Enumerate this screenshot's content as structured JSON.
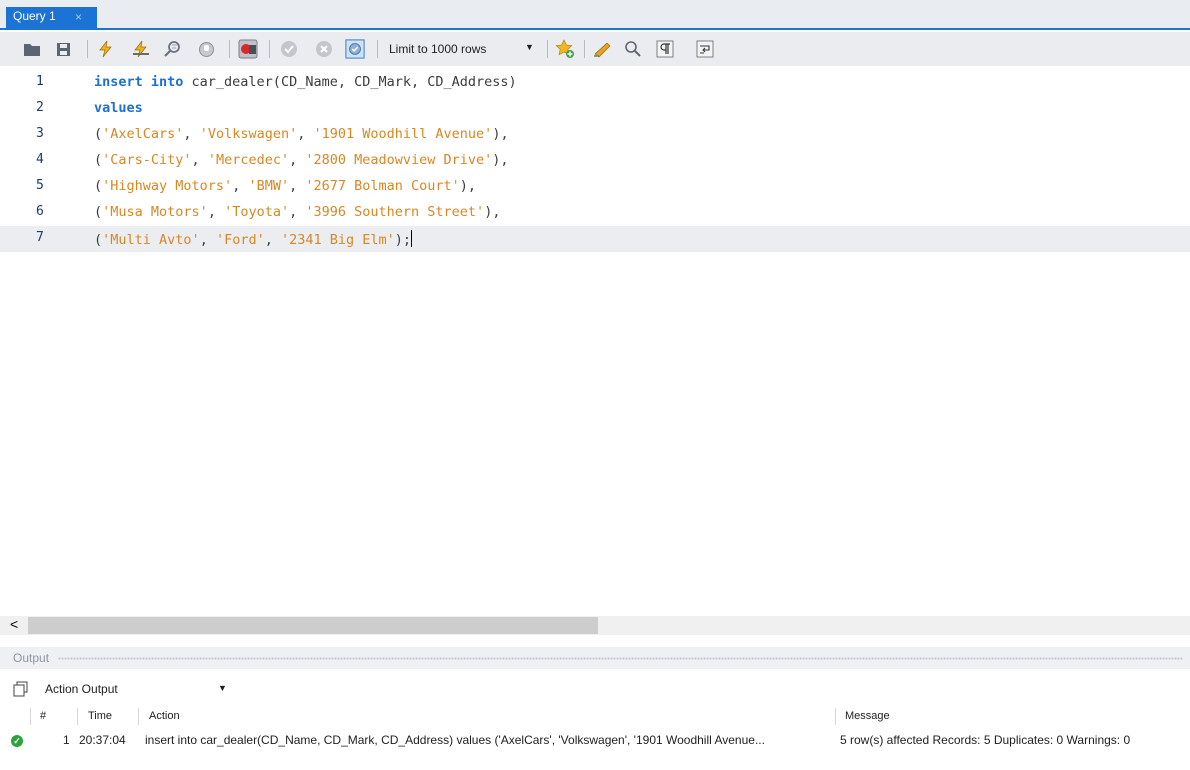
{
  "tab": {
    "title": "Query 1",
    "close_glyph": "×"
  },
  "toolbar": {
    "icons": [
      "open-folder-icon",
      "save-icon",
      "execute-icon",
      "execute-current-icon",
      "explain-icon",
      "stop-icon",
      "toggle-stop-on-error-icon",
      "commit-icon",
      "rollback-icon",
      "autocommit-icon",
      "add-snippet-icon",
      "beautify-icon",
      "find-icon",
      "invisible-chars-icon",
      "wrap-lines-icon"
    ],
    "limit_label": "Limit to 1000 rows"
  },
  "editor": {
    "lines": [
      {
        "num": "1",
        "parts": [
          {
            "t": "insert into",
            "c": "kw"
          },
          {
            "t": " car_dealer(CD_Name, CD_Mark, CD_Address)",
            "c": ""
          }
        ]
      },
      {
        "num": "2",
        "parts": [
          {
            "t": "values",
            "c": "kw"
          }
        ]
      },
      {
        "num": "3",
        "parts": [
          {
            "t": "(",
            "c": ""
          },
          {
            "t": "'AxelCars'",
            "c": "str"
          },
          {
            "t": ", ",
            "c": ""
          },
          {
            "t": "'Volkswagen'",
            "c": "str"
          },
          {
            "t": ", ",
            "c": ""
          },
          {
            "t": "'1901 Woodhill Avenue'",
            "c": "str"
          },
          {
            "t": "),",
            "c": ""
          }
        ]
      },
      {
        "num": "4",
        "parts": [
          {
            "t": "(",
            "c": ""
          },
          {
            "t": "'Cars-City'",
            "c": "str"
          },
          {
            "t": ", ",
            "c": ""
          },
          {
            "t": "'Mercedec'",
            "c": "str"
          },
          {
            "t": ", ",
            "c": ""
          },
          {
            "t": "'2800 Meadowview Drive'",
            "c": "str"
          },
          {
            "t": "),",
            "c": ""
          }
        ]
      },
      {
        "num": "5",
        "parts": [
          {
            "t": "(",
            "c": ""
          },
          {
            "t": "'Highway Motors'",
            "c": "str"
          },
          {
            "t": ", ",
            "c": ""
          },
          {
            "t": "'BMW'",
            "c": "str"
          },
          {
            "t": ", ",
            "c": ""
          },
          {
            "t": "'2677 Bolman Court'",
            "c": "str"
          },
          {
            "t": "),",
            "c": ""
          }
        ]
      },
      {
        "num": "6",
        "parts": [
          {
            "t": "(",
            "c": ""
          },
          {
            "t": "'Musa Motors'",
            "c": "str"
          },
          {
            "t": ", ",
            "c": ""
          },
          {
            "t": "'Toyota'",
            "c": "str"
          },
          {
            "t": ", ",
            "c": ""
          },
          {
            "t": "'3996 Southern Street'",
            "c": "str"
          },
          {
            "t": "),",
            "c": ""
          }
        ]
      },
      {
        "num": "7",
        "current": true,
        "parts": [
          {
            "t": "(",
            "c": ""
          },
          {
            "t": "'Multi Avto'",
            "c": "str"
          },
          {
            "t": ", ",
            "c": ""
          },
          {
            "t": "'Ford'",
            "c": "str"
          },
          {
            "t": ", ",
            "c": ""
          },
          {
            "t": "'2341 Big Elm'",
            "c": "str"
          },
          {
            "t": ");",
            "c": ""
          }
        ]
      }
    ]
  },
  "scrollbar": {
    "left_arrow": "<"
  },
  "output": {
    "title": "Output",
    "selector_label": "Action Output",
    "columns": {
      "num": "#",
      "time": "Time",
      "action": "Action",
      "message": "Message"
    },
    "rows": [
      {
        "num": "1",
        "time": "20:37:04",
        "action": "insert into car_dealer(CD_Name, CD_Mark, CD_Address) values ('AxelCars', 'Volkswagen', '1901 Woodhill Avenue...",
        "message": "5 row(s) affected Records: 5  Duplicates: 0  Warnings: 0",
        "status": "success"
      }
    ]
  },
  "colors": {
    "accent": "#1b74d3",
    "keyword": "#1e6fcf",
    "string": "#d98725",
    "success": "#2aa43a"
  }
}
